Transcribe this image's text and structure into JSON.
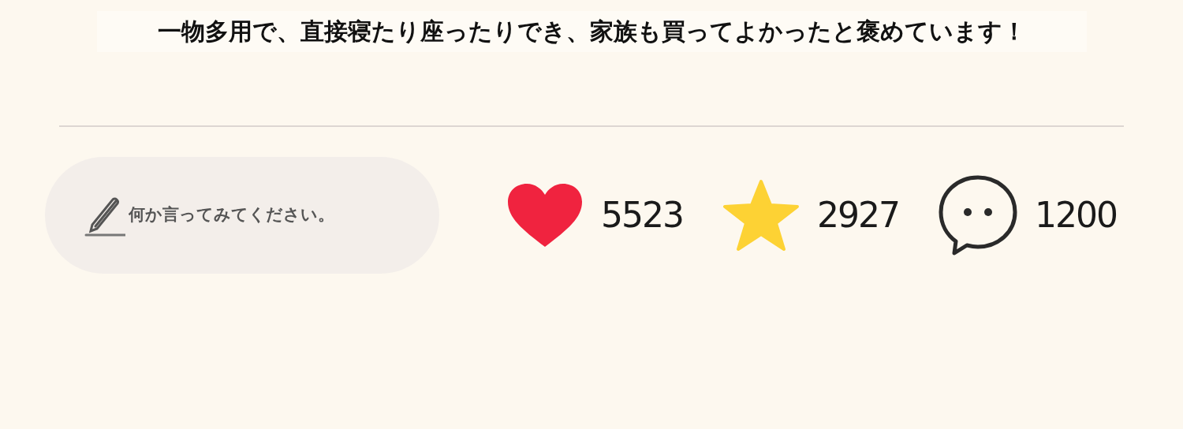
{
  "headline": "一物多用で、直接寝たり座ったりでき、家族も買ってよかったと褒めています！",
  "comment_field": {
    "placeholder": "何か言ってみてください。"
  },
  "stats": [
    {
      "kind": "like",
      "count": "5523"
    },
    {
      "kind": "favorite",
      "count": "2927"
    },
    {
      "kind": "comment",
      "count": "1200"
    }
  ]
}
